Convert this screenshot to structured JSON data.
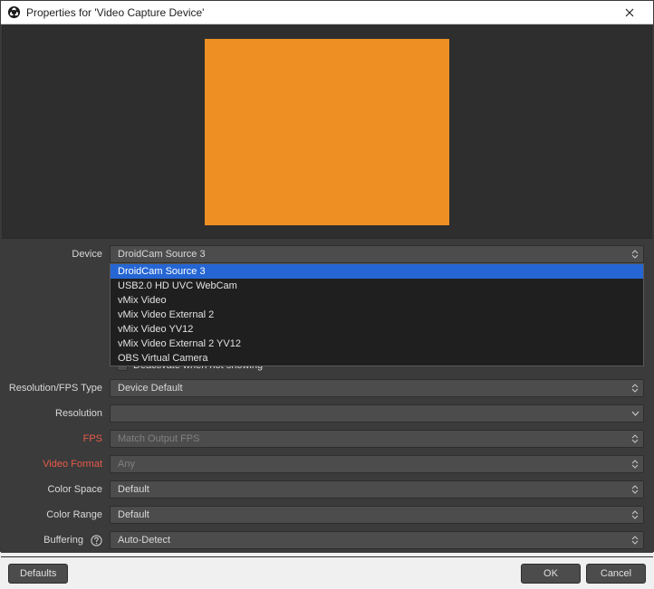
{
  "window": {
    "title": "Properties for 'Video Capture Device'"
  },
  "preview": {
    "color": "#ed8f22"
  },
  "fields": {
    "device": {
      "label": "Device",
      "value": "DroidCam Source 3",
      "open": true,
      "options": [
        "DroidCam Source 3",
        "USB2.0 HD UVC WebCam",
        "vMix Video",
        "vMix Video External 2",
        "vMix Video YV12",
        "vMix Video External 2 YV12",
        "OBS Virtual Camera"
      ]
    },
    "deactivate": {
      "label": "Deactivate when not showing"
    },
    "res_type": {
      "label": "Resolution/FPS Type",
      "value": "Device Default"
    },
    "resolution": {
      "label": "Resolution",
      "value": ""
    },
    "fps": {
      "label": "FPS",
      "value": "Match Output FPS"
    },
    "video_format": {
      "label": "Video Format",
      "value": "Any"
    },
    "color_space": {
      "label": "Color Space",
      "value": "Default"
    },
    "color_range": {
      "label": "Color Range",
      "value": "Default"
    },
    "buffering": {
      "label": "Buffering",
      "value": "Auto-Detect"
    }
  },
  "buttons": {
    "defaults": "Defaults",
    "ok": "OK",
    "cancel": "Cancel"
  }
}
